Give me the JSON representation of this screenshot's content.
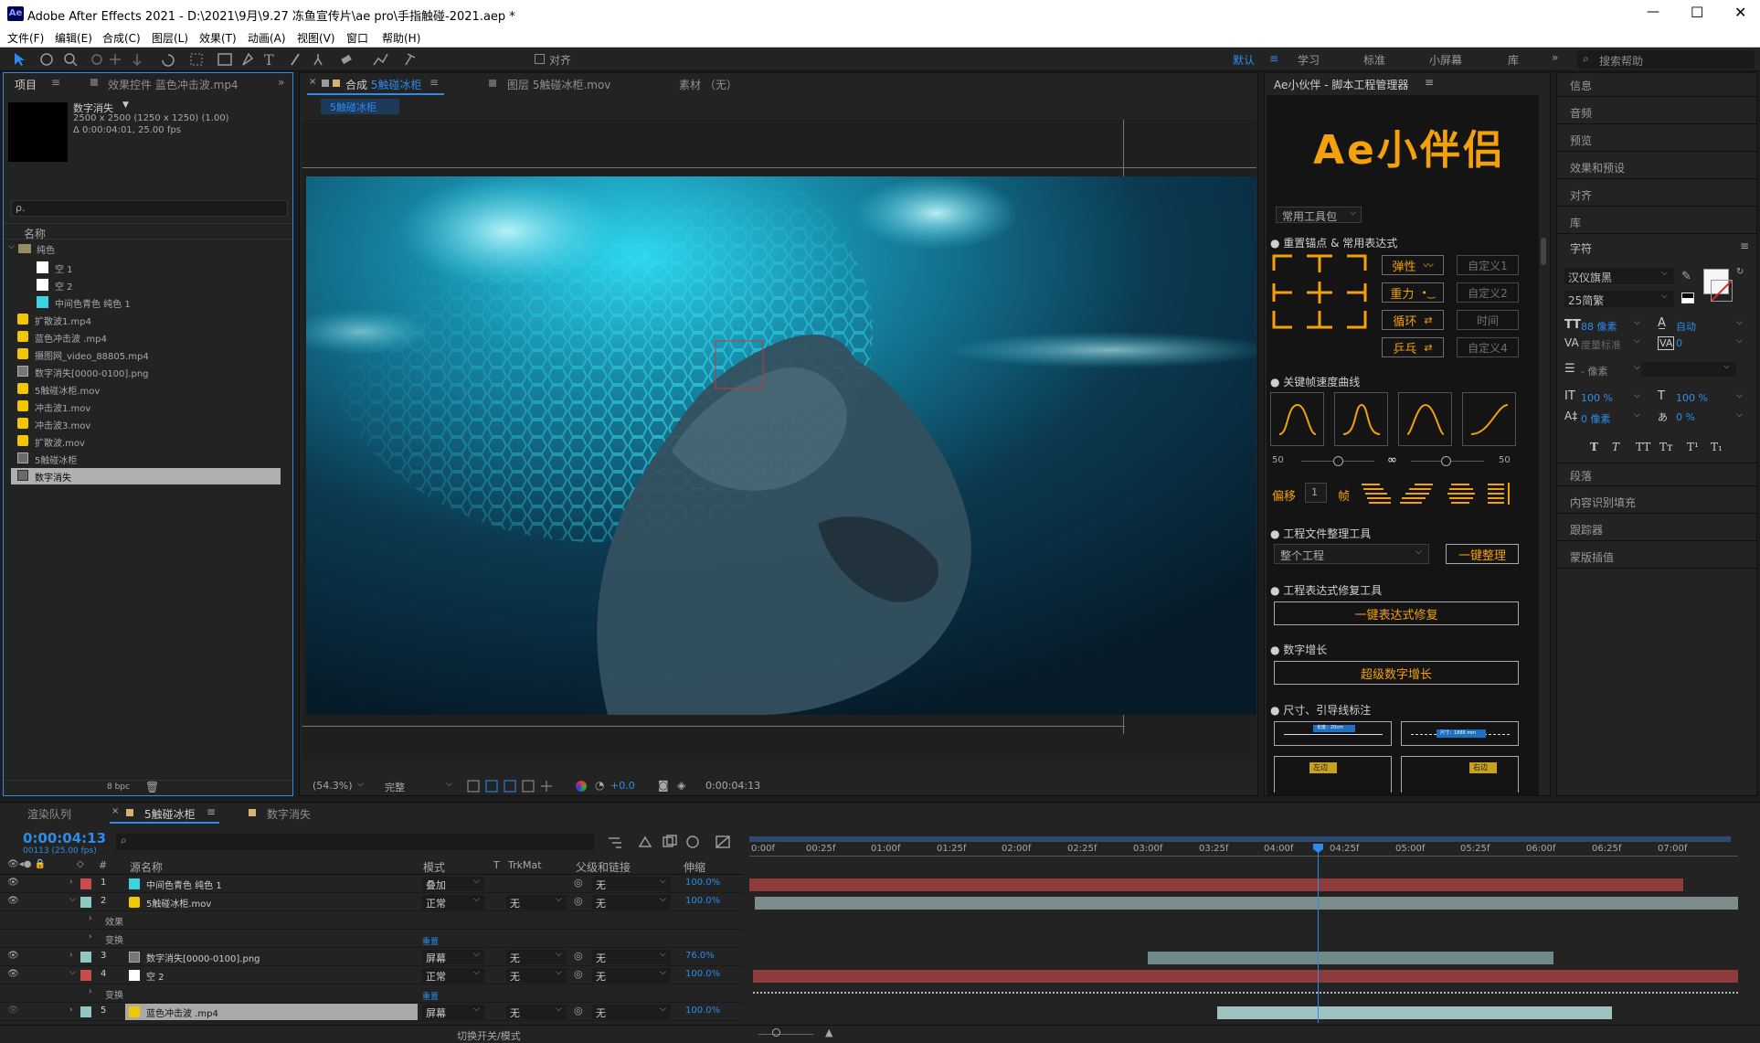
{
  "app": {
    "title": "Adobe After Effects 2021 - D:\\2021\\9月\\9.27 冻鱼宣传片\\ae pro\\手指触碰-2021.aep *",
    "logo": "Ae"
  },
  "window_controls": {
    "minimize": "—",
    "maximize": "☐",
    "close": "✕"
  },
  "menu": [
    "文件(F)",
    "编辑(E)",
    "合成(C)",
    "图层(L)",
    "效果(T)",
    "动画(A)",
    "视图(V)",
    "窗口",
    "帮助(H)"
  ],
  "toolbar": {
    "align_label": "对齐",
    "workspaces": [
      "默认",
      "学习",
      "标准",
      "小屏幕",
      "库"
    ],
    "search_placeholder": "搜索帮助"
  },
  "project_panel": {
    "tabs": [
      "项目",
      "效果控件 蓝色冲击波.mp4"
    ],
    "selected_name": "数字消失",
    "info_lines": [
      "2500 x 2500  (1250 x 1250) (1.00)",
      "Δ 0:00:04:01, 25.00 fps"
    ],
    "search_placeholder": "ρ.",
    "column_name": "名称",
    "folder": "纯色",
    "folder_items": [
      "空 1",
      "空 2",
      "中间色青色 纯色 1"
    ],
    "items": [
      "扩散波1.mp4",
      "蓝色冲击波 .mp4",
      "摄图网_video_88805.mp4",
      "数字消失[0000-0100].png",
      "5触碰冰柜.mov",
      "冲击波1.mov",
      "冲击波3.mov",
      "扩散波.mov",
      "5触碰冰柜",
      "数字消失"
    ],
    "bpc": "8 bpc"
  },
  "viewer": {
    "tabs": [
      "合成 5触碰冰柜",
      "图层 5触碰冰柜.mov",
      "素材 （无）"
    ],
    "active_comp": "5触碰冰柜",
    "zoom": "(54.3%)",
    "resolution": "完整",
    "exposure": "+0.0",
    "timecode": "0:00:04:13"
  },
  "script_panel": {
    "title": "Ae小伙伴 - 脚本工程管理器",
    "logo_text": "Ae小伴侣",
    "dropdown": "常用工具包",
    "section1": "● 重置锚点 & 常用表达式",
    "expr_buttons": [
      "弹性",
      "重力",
      "循环",
      "乒乓"
    ],
    "custom_buttons": [
      "自定义1",
      "自定义2",
      "时间",
      "自定义4"
    ],
    "section2": "● 关键帧速度曲线",
    "slider_left": "50",
    "slider_right": "50",
    "infinity": "∞",
    "offset_label": "偏移",
    "offset_value": "1",
    "frame_label": "帧",
    "section3": "● 工程文件整理工具",
    "project_dropdown": "整个工程",
    "organize_button": "一键整理",
    "section4": "● 工程表达式修复工具",
    "fix_button": "一键表达式修复",
    "section5": "● 数字增长",
    "number_button": "超级数字增长",
    "section6": "● 尺寸、引导线标注",
    "dim_label1": "长度：20cm",
    "dim_label2": "尺寸：1888 mm",
    "left_label": "左边",
    "right_label": "右边"
  },
  "right_panels": {
    "items": [
      "信息",
      "音频",
      "预览",
      "效果和预设",
      "对齐",
      "库"
    ],
    "character_title": "字符",
    "font": "汉仪旗黑",
    "style": "25简繁",
    "size": "88 像素",
    "leading": "自动",
    "tracking_label": "度量标准",
    "tracking": "0",
    "stroke": "- 像素",
    "vscale": "100 %",
    "hscale": "100 %",
    "baseline": "0 像素",
    "tsume": "0 %",
    "text_styles": [
      "T",
      "T",
      "TT",
      "Tт",
      "T¹",
      "T₁"
    ],
    "lower_items": [
      "段落",
      "内容识别填充",
      "跟踪器",
      "蒙版插值"
    ]
  },
  "timeline": {
    "tabs": [
      "渲染队列",
      "5触碰冰柜",
      "数字消失"
    ],
    "timecode": "0:00:04:13",
    "frame_info": "00113 (25.00 fps)",
    "columns": [
      "#",
      "源名称",
      "模式",
      "T",
      "TrkMat",
      "父级和链接",
      "伸缩"
    ],
    "ruler": [
      "0:00f",
      "00:25f",
      "01:00f",
      "01:25f",
      "02:00f",
      "02:25f",
      "03:00f",
      "03:25f",
      "04:00f",
      "04:25f",
      "05:00f",
      "05:25f",
      "06:00f",
      "06:25f",
      "07:00f",
      "07"
    ],
    "sub_effects": "效果",
    "sub_transform": "变换",
    "reset": "重置",
    "bottom_label": "切换开关/模式",
    "layers": [
      {
        "num": "1",
        "name": "中间色青色 纯色 1",
        "mode": "叠加",
        "trk": "",
        "parent": "无",
        "stretch": "100.0%",
        "color": "#c94b4b",
        "icon": "#3cd3e0"
      },
      {
        "num": "2",
        "name": "5触碰冰柜.mov",
        "mode": "正常",
        "trk": "无",
        "parent": "无",
        "stretch": "100.0%",
        "color": "#8fc7c2",
        "icon": "#f2c700"
      },
      {
        "num": "3",
        "name": "数字消失[0000-0100].png",
        "mode": "屏幕",
        "trk": "无",
        "parent": "无",
        "stretch": "76.0%",
        "color": "#8fc7c2",
        "icon": "#888888"
      },
      {
        "num": "4",
        "name": "空 2",
        "mode": "正常",
        "trk": "无",
        "parent": "无",
        "stretch": "100.0%",
        "color": "#c94b4b",
        "icon": "#ffffff"
      },
      {
        "num": "5",
        "name": "蓝色冲击波 .mp4",
        "mode": "屏幕",
        "trk": "无",
        "parent": "无",
        "stretch": "100.0%",
        "color": "#8fc7c2",
        "icon": "#f2c700"
      }
    ]
  }
}
